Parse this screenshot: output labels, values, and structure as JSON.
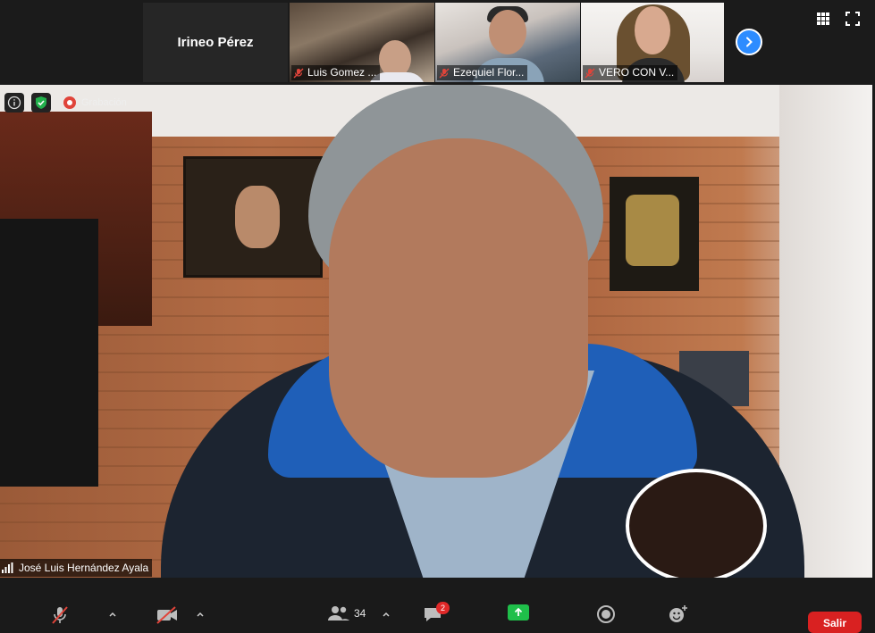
{
  "gallery": {
    "tiles": [
      {
        "name": "Irineo Pérez",
        "type": "name-only"
      },
      {
        "name": "Luis Gomez ...",
        "type": "video"
      },
      {
        "name": "Ezequiel Flor...",
        "type": "video"
      },
      {
        "name": "VERO CON V...",
        "type": "video"
      }
    ]
  },
  "status": {
    "recording_label": "Grabación"
  },
  "speaker": {
    "name": "José Luis Hernández Ayala"
  },
  "toolbar": {
    "participants_count": "34",
    "chat_badge": "2",
    "leave_label": "Salir"
  },
  "colors": {
    "accent": "#2d8cff",
    "leave": "#d92121",
    "share": "#1fbf4a",
    "muted": "#e0443a"
  }
}
